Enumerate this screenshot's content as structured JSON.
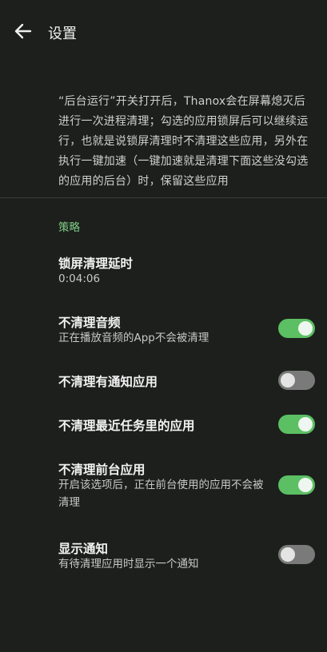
{
  "appbar": {
    "title": "设置"
  },
  "description": "“后台运行”开关打开后，Thanox会在屏幕熄灭后进行一次进程清理；勾选的应用锁屏后可以继续运行，也就是说锁屏清理时不清理这些应用，另外在执行一键加速（一键加速就是清理下面这些没勾选的应用的后台）时，保留这些应用",
  "section": {
    "header": "策略"
  },
  "settings": {
    "lock_delay": {
      "title": "锁屏清理延时",
      "value": "0:04:06"
    },
    "no_audio": {
      "title": "不清理音频",
      "subtitle": "正在播放音频的App不会被清理",
      "checked": true
    },
    "no_notification": {
      "title": "不清理有通知应用",
      "checked": false
    },
    "no_recent": {
      "title": "不清理最近任务里的应用",
      "checked": true
    },
    "no_foreground": {
      "title": "不清理前台应用",
      "subtitle": "开启该选项后，正在前台使用的应用不会被清理",
      "checked": true
    },
    "show_notification": {
      "title": "显示通知",
      "subtitle": "有待清理应用时显示一个通知",
      "checked": false
    }
  },
  "colors": {
    "accent": "#5cbf63",
    "background": "#1c1f1c",
    "section_header": "#7fcf87"
  }
}
